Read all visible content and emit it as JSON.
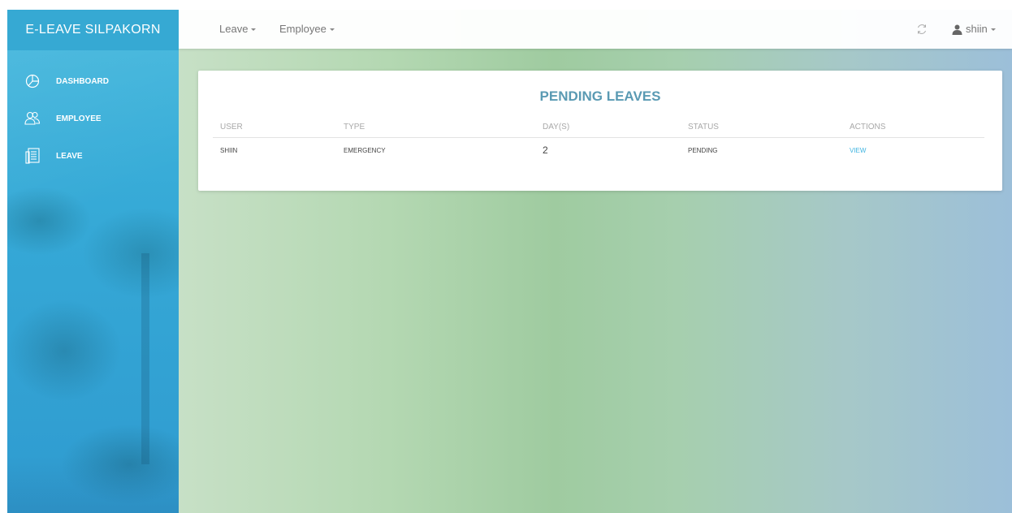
{
  "sidebar": {
    "brand": "E-LEAVE SILPAKORN",
    "items": [
      {
        "label": "DASHBOARD",
        "icon": "pie-chart-icon"
      },
      {
        "label": "EMPLOYEE",
        "icon": "users-icon"
      },
      {
        "label": "LEAVE",
        "icon": "document-icon"
      }
    ]
  },
  "topbar": {
    "menus": [
      {
        "label": "Leave"
      },
      {
        "label": "Employee"
      }
    ],
    "refresh_icon": "refresh-icon",
    "user": {
      "label": "shiin",
      "icon": "user-icon"
    }
  },
  "card": {
    "title": "PENDING LEAVES",
    "columns": [
      "USER",
      "TYPE",
      "DAY(S)",
      "STATUS",
      "ACTIONS"
    ],
    "rows": [
      {
        "user": "SHIIN",
        "type": "EMERGENCY",
        "days": "2",
        "status": "PENDING",
        "action": "VIEW"
      }
    ]
  },
  "colors": {
    "sidebar": "#36a9d3",
    "title": "#5a9ab3",
    "link": "#3fb4e0"
  }
}
